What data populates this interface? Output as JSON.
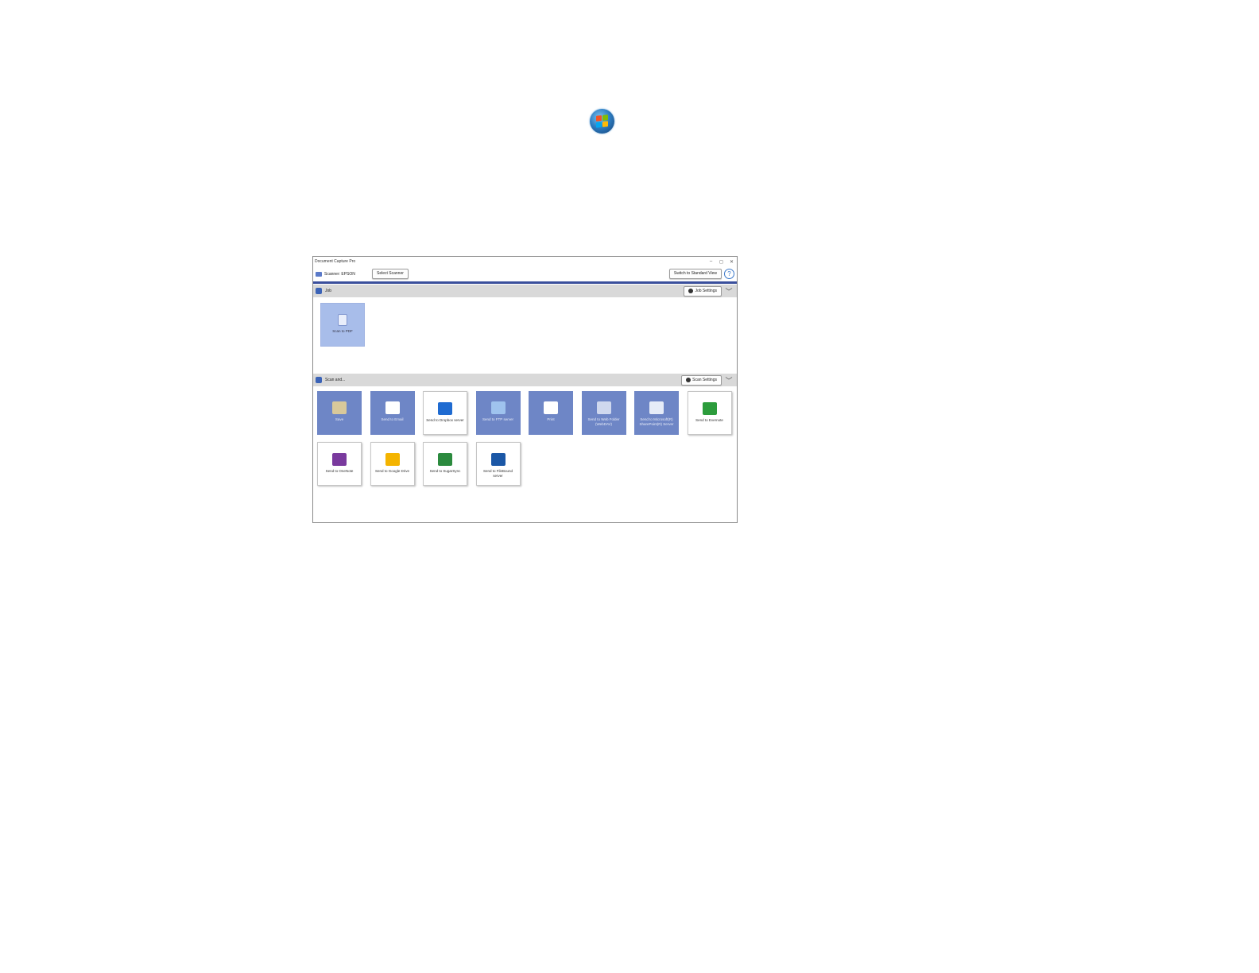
{
  "app": {
    "title": "Document Capture Pro",
    "window_controls": [
      "–",
      "◻",
      "✕"
    ]
  },
  "toolbar": {
    "scanner_label": "Scanner: EPSON",
    "select_scanner": "Select Scanner",
    "switch_view": "Switch to Standard View",
    "help": "?"
  },
  "job_section": {
    "label": "Job",
    "settings_label": "Job Settings",
    "tiles": [
      {
        "label": "Scan to PDF",
        "icon": "document-icon"
      }
    ]
  },
  "scan_section": {
    "label": "Scan and...",
    "settings_label": "Scan Settings",
    "tiles": [
      {
        "label": "Save",
        "icon": "folder-icon",
        "style": "blue"
      },
      {
        "label": "Send to Email",
        "icon": "email-icon",
        "style": "blue"
      },
      {
        "label": "Send to Dropbox server",
        "icon": "dropbox-icon",
        "style": "white"
      },
      {
        "label": "Send to FTP server",
        "icon": "ftp-icon",
        "style": "blue"
      },
      {
        "label": "Print",
        "icon": "printer-icon",
        "style": "blue"
      },
      {
        "label": "Send to Web Folder (WebDAV)",
        "icon": "web-folder-icon",
        "style": "blue"
      },
      {
        "label": "Send to Microsoft(R) SharePoint(R) Server",
        "icon": "sharepoint-icon",
        "style": "blue"
      },
      {
        "label": "Send to Evernote",
        "icon": "evernote-icon",
        "style": "white"
      },
      {
        "label": "Send to OneNote",
        "icon": "onenote-icon",
        "style": "white"
      },
      {
        "label": "Send to Google Drive",
        "icon": "google-drive-icon",
        "style": "white"
      },
      {
        "label": "Send to SugarSync",
        "icon": "sugarsync-icon",
        "style": "white"
      },
      {
        "label": "Send to FileBound server",
        "icon": "filebound-icon",
        "style": "white"
      }
    ]
  },
  "colors": {
    "accent_bar": "#3a4f9c",
    "tile_blue": "#6e86c6",
    "tile_selected": "#a8bdea",
    "section_bar": "#d9d9d9"
  }
}
